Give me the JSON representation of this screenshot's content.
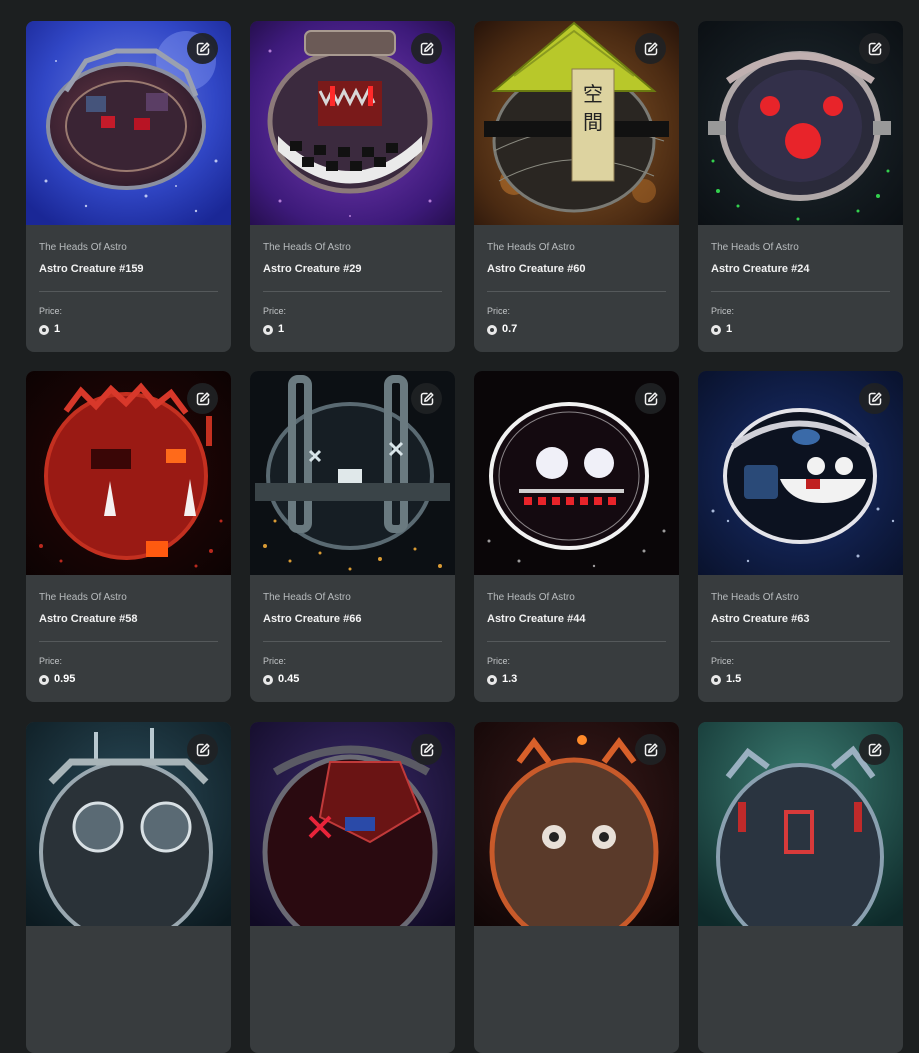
{
  "cards": [
    {
      "collection": "The Heads Of Astro",
      "name": "Astro Creature #159",
      "price_label": "Price:",
      "price": "1",
      "edit_icon": "edit-icon",
      "currency_icon": "coin-icon"
    },
    {
      "collection": "The Heads Of Astro",
      "name": "Astro Creature #29",
      "price_label": "Price:",
      "price": "1",
      "edit_icon": "edit-icon",
      "currency_icon": "coin-icon"
    },
    {
      "collection": "The Heads Of Astro",
      "name": "Astro Creature #60",
      "price_label": "Price:",
      "price": "0.7",
      "edit_icon": "edit-icon",
      "currency_icon": "coin-icon"
    },
    {
      "collection": "The Heads Of Astro",
      "name": "Astro Creature #24",
      "price_label": "Price:",
      "price": "1",
      "edit_icon": "edit-icon",
      "currency_icon": "coin-icon"
    },
    {
      "collection": "The Heads Of Astro",
      "name": "Astro Creature #58",
      "price_label": "Price:",
      "price": "0.95",
      "edit_icon": "edit-icon",
      "currency_icon": "coin-icon"
    },
    {
      "collection": "The Heads Of Astro",
      "name": "Astro Creature #66",
      "price_label": "Price:",
      "price": "0.45",
      "edit_icon": "edit-icon",
      "currency_icon": "coin-icon"
    },
    {
      "collection": "The Heads Of Astro",
      "name": "Astro Creature #44",
      "price_label": "Price:",
      "price": "1.3",
      "edit_icon": "edit-icon",
      "currency_icon": "coin-icon"
    },
    {
      "collection": "The Heads Of Astro",
      "name": "Astro Creature #63",
      "price_label": "Price:",
      "price": "1.5",
      "edit_icon": "edit-icon",
      "currency_icon": "coin-icon"
    },
    {
      "edit_icon": "edit-icon"
    },
    {
      "edit_icon": "edit-icon"
    },
    {
      "edit_icon": "edit-icon"
    },
    {
      "edit_icon": "edit-icon"
    }
  ],
  "colors": {
    "page_background": "#1c1f20",
    "card_background": "#383c3e",
    "text_primary": "#f2f2f2",
    "text_secondary": "#b8bcbe"
  }
}
